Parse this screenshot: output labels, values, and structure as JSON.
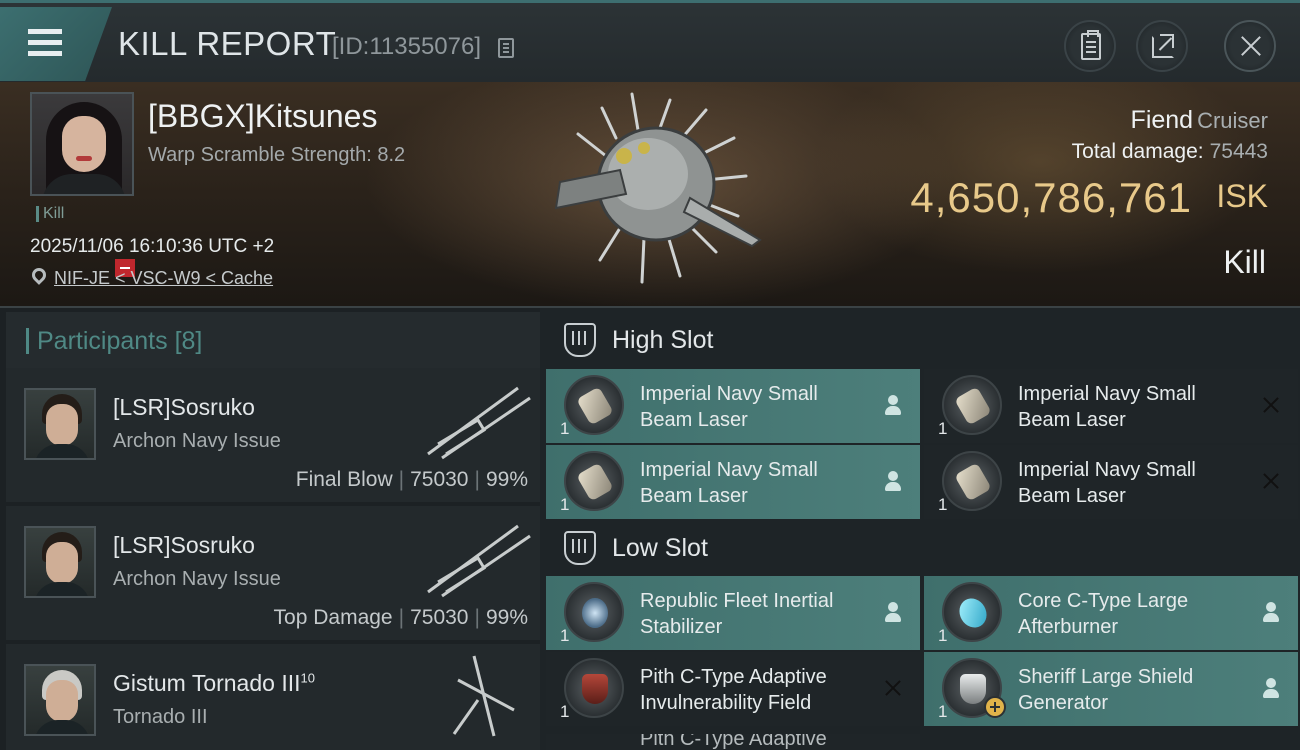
{
  "header": {
    "title": "KILL REPORT",
    "report_id": "[ID:11355076]",
    "icons": {
      "menu": "menu-icon",
      "copy": "copy-icon",
      "clipboard": "clipboard-icon",
      "share": "share-icon",
      "close": "close-icon"
    }
  },
  "victim": {
    "name": "[BBGX]Kitsunes",
    "warp_scramble": "Warp Scramble Strength: 8.2",
    "tag": "Kill",
    "timestamp": "2025/11/06 16:10:36 UTC +2",
    "location": "NIF-JE < VSC-W9 < Cache",
    "ship_name": "Fiend",
    "ship_class": "Cruiser",
    "total_damage_label": "Total damage:",
    "total_damage": "75443",
    "isk_value": "4,650,786,761",
    "isk_unit": "ISK",
    "result": "Kill"
  },
  "participants": {
    "title": "Participants",
    "count": "[8]",
    "rows": [
      {
        "name": "[LSR]Sosruko",
        "sup": "",
        "ship": "Archon Navy Issue",
        "role": "Final Blow",
        "damage": "75030",
        "percent": "99%"
      },
      {
        "name": "[LSR]Sosruko",
        "sup": "",
        "ship": "Archon Navy Issue",
        "role": "Top Damage",
        "damage": "75030",
        "percent": "99%"
      },
      {
        "name": "Gistum Tornado III",
        "sup": "10",
        "ship": "Tornado III",
        "role": "",
        "damage": "",
        "percent": ""
      }
    ]
  },
  "slots": {
    "high": {
      "label": "High Slot",
      "modules": [
        {
          "name": "Imperial Navy Small Beam Laser",
          "qty": "1",
          "status": "fitted"
        },
        {
          "name": "Imperial Navy Small Beam Laser",
          "qty": "1",
          "status": "destroyed"
        },
        {
          "name": "Imperial Navy Small Beam Laser",
          "qty": "1",
          "status": "fitted"
        },
        {
          "name": "Imperial Navy Small Beam Laser",
          "qty": "1",
          "status": "destroyed"
        }
      ]
    },
    "low": {
      "label": "Low Slot",
      "modules": [
        {
          "name": "Republic Fleet Inertial Stabilizer",
          "qty": "1",
          "status": "fitted"
        },
        {
          "name": "Core C-Type Large Afterburner",
          "qty": "1",
          "status": "fitted"
        },
        {
          "name": "Pith C-Type Adaptive Invulnerability Field",
          "qty": "1",
          "status": "destroyed"
        },
        {
          "name": "Sheriff Large Shield Generator",
          "qty": "1",
          "status": "fitted"
        }
      ],
      "partial": "Pith C-Type Adaptive"
    }
  },
  "colors": {
    "accent": "#4f8985",
    "isk": "#e8c98a",
    "fitted_bg": "#4d7f7b",
    "destroyed_bg": "#1f2528"
  }
}
